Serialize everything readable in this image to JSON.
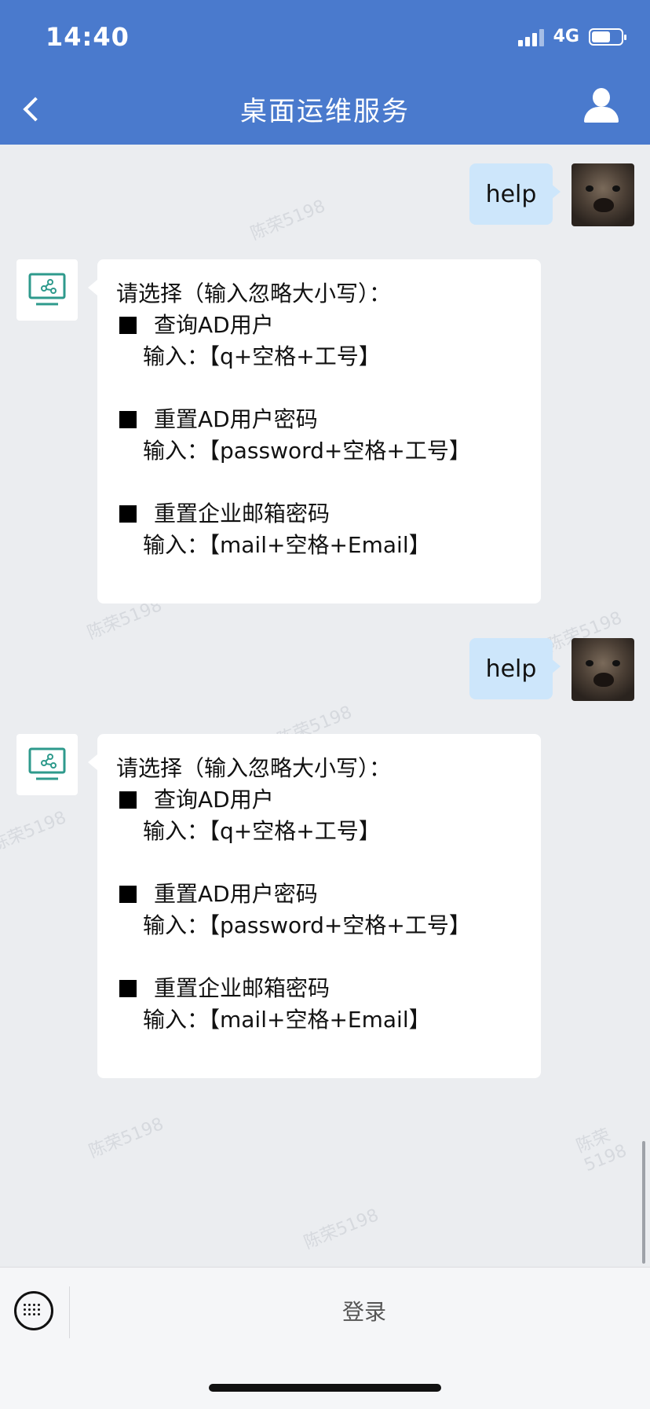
{
  "status_bar": {
    "time": "14:40",
    "network": "4G",
    "battery_level": 0.65
  },
  "header": {
    "title": "桌面运维服务",
    "back_icon": "chevron-left-icon",
    "profile_icon": "person-icon"
  },
  "watermark": "陈荣5198",
  "messages": [
    {
      "sender": "user",
      "text": "help"
    },
    {
      "sender": "bot",
      "intro": "请选择（输入忽略大小写）：",
      "items": [
        {
          "title": "查询AD用户",
          "input": "输入：【q+空格+工号】"
        },
        {
          "title": "重置AD用户密码",
          "input": "输入：【password+空格+工号】"
        },
        {
          "title": "重置企业邮箱密码",
          "input": "输入：【mail+空格+Email】"
        }
      ]
    },
    {
      "sender": "user",
      "text": "help"
    },
    {
      "sender": "bot",
      "intro": "请选择（输入忽略大小写）：",
      "items": [
        {
          "title": "查询AD用户",
          "input": "输入：【q+空格+工号】"
        },
        {
          "title": "重置AD用户密码",
          "input": "输入：【password+空格+工号】"
        },
        {
          "title": "重置企业邮箱密码",
          "input": "输入：【mail+空格+Email】"
        }
      ]
    }
  ],
  "bottom_bar": {
    "login_label": "登录",
    "keyboard_icon": "keyboard-icon"
  },
  "colors": {
    "header": "#4a7acd",
    "user_bubble": "#cde6fb",
    "background": "#ebedf0"
  }
}
